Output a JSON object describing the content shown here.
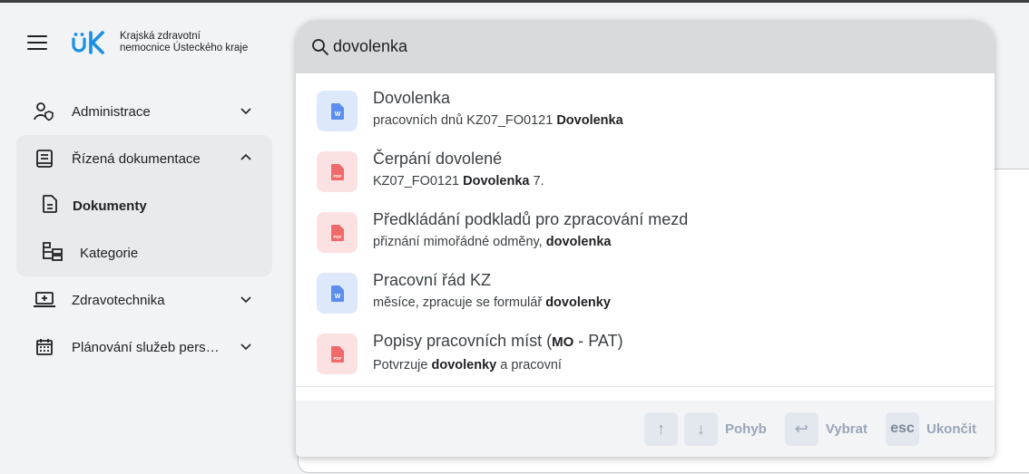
{
  "app": {
    "logo_line1": "Krajská zdravotní",
    "logo_line2": "nemocnice Ústeckého kraje",
    "brand_color": "#1a8fe3"
  },
  "sidebar": {
    "items": [
      {
        "label": "Administrace",
        "icon": "user-shield-icon",
        "expanded": false
      },
      {
        "label": "Řízená dokumentace",
        "icon": "book-icon",
        "expanded": true,
        "children": [
          {
            "label": "Dokumenty",
            "icon": "document-icon",
            "active": true
          },
          {
            "label": "Kategorie",
            "icon": "category-tree-icon",
            "active": false
          }
        ]
      },
      {
        "label": "Zdravotechnika",
        "icon": "medical-laptop-icon",
        "expanded": false
      },
      {
        "label": "Plánování služeb pers…",
        "icon": "calendar-icon",
        "expanded": false
      }
    ]
  },
  "search": {
    "query": "dovolenka",
    "results": [
      {
        "type": "word",
        "title": "Dovolenka",
        "snippet_pre": "pracovních dnů KZ07_FO0121 ",
        "snippet_bold": "Dovolenka",
        "snippet_post": ""
      },
      {
        "type": "pdf",
        "title": "Čerpání dovolené",
        "snippet_pre": "KZ07_FO0121 ",
        "snippet_bold": "Dovolenka",
        "snippet_post": " 7."
      },
      {
        "type": "pdf",
        "title": "Předkládání podkladů pro zpracování mezd",
        "snippet_pre": "přiznání mimořádné odměny, ",
        "snippet_bold": "dovolenka",
        "snippet_post": ""
      },
      {
        "type": "word",
        "title": "Pracovní řád KZ",
        "snippet_pre": "měsíce, zpracuje se formulář ",
        "snippet_bold": "dovolenky",
        "snippet_post": ""
      },
      {
        "type": "pdf",
        "title_pre": "Popisy pracovních míst (",
        "title_bold": "MO",
        "title_post": " - PAT)",
        "snippet_pre": "Potvrzuje ",
        "snippet_bold": "dovolenky",
        "snippet_post": " a pracovní"
      }
    ],
    "footer": {
      "up_key": "↑",
      "down_key": "↓",
      "move_label": "Pohyb",
      "enter_key": "↩",
      "select_label": "Vybrat",
      "esc_key": "esc",
      "close_label": "Ukončit"
    }
  }
}
